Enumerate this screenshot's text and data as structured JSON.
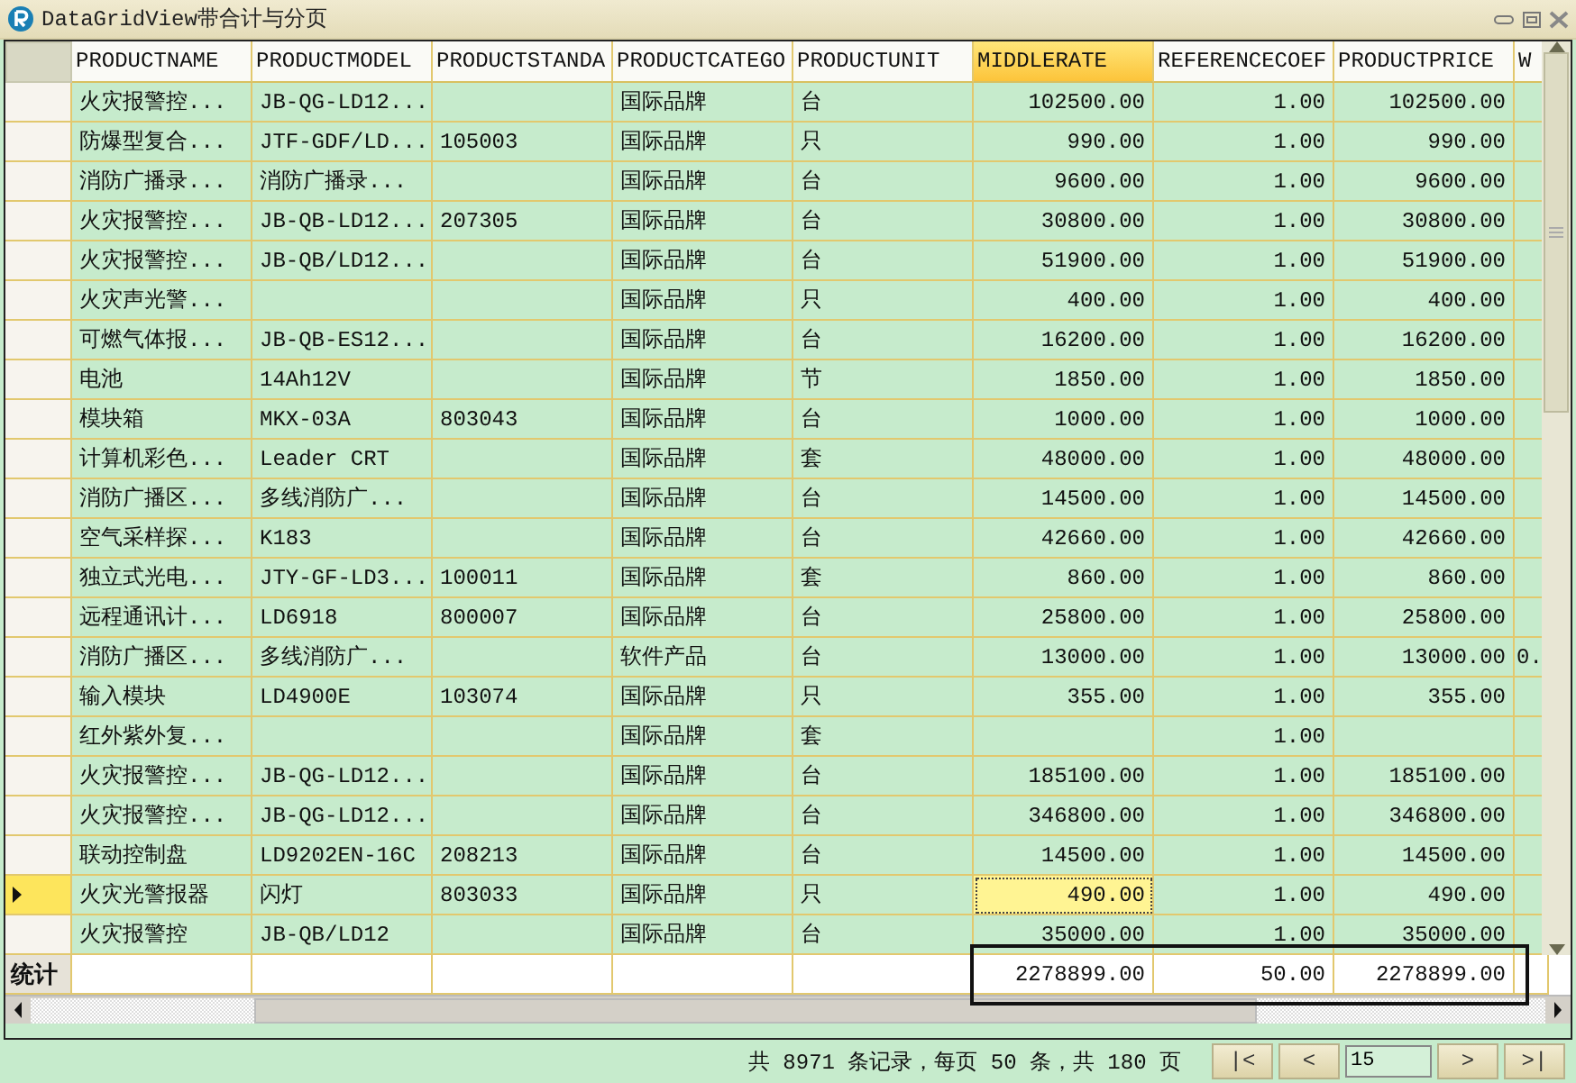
{
  "window": {
    "title": "DataGridView带合计与分页"
  },
  "grid": {
    "columns": [
      {
        "label": "PRODUCTNAME",
        "kind": "text",
        "selected": false
      },
      {
        "label": "PRODUCTMODEL",
        "kind": "text",
        "selected": false
      },
      {
        "label": "PRODUCTSTANDA",
        "kind": "text",
        "selected": false
      },
      {
        "label": "PRODUCTCATEGO",
        "kind": "text",
        "selected": false
      },
      {
        "label": "PRODUCTUNIT",
        "kind": "text",
        "selected": false
      },
      {
        "label": "MIDDLERATE",
        "kind": "number",
        "selected": true
      },
      {
        "label": "REFERENCECOEF",
        "kind": "number",
        "selected": false
      },
      {
        "label": "PRODUCTPRICE",
        "kind": "number",
        "selected": false
      },
      {
        "label": "W",
        "kind": "text",
        "selected": false
      }
    ],
    "rows": [
      {
        "selected": false,
        "cells": [
          "火灾报警控...",
          "JB-QG-LD12...",
          "",
          "国际品牌",
          "台",
          "102500.00",
          "1.00",
          "102500.00",
          ""
        ]
      },
      {
        "selected": false,
        "cells": [
          "防爆型复合...",
          "JTF-GDF/LD...",
          "105003",
          "国际品牌",
          "只",
          "990.00",
          "1.00",
          "990.00",
          ""
        ]
      },
      {
        "selected": false,
        "cells": [
          "消防广播录...",
          "消防广播录...",
          "",
          "国际品牌",
          "台",
          "9600.00",
          "1.00",
          "9600.00",
          ""
        ]
      },
      {
        "selected": false,
        "cells": [
          "火灾报警控...",
          "JB-QB-LD12...",
          "207305",
          "国际品牌",
          "台",
          "30800.00",
          "1.00",
          "30800.00",
          ""
        ]
      },
      {
        "selected": false,
        "cells": [
          "火灾报警控...",
          "JB-QB/LD12...",
          "",
          "国际品牌",
          "台",
          "51900.00",
          "1.00",
          "51900.00",
          ""
        ]
      },
      {
        "selected": false,
        "cells": [
          "火灾声光警...",
          "",
          "",
          "国际品牌",
          "只",
          "400.00",
          "1.00",
          "400.00",
          ""
        ]
      },
      {
        "selected": false,
        "cells": [
          "可燃气体报...",
          "JB-QB-ES12...",
          "",
          "国际品牌",
          "台",
          "16200.00",
          "1.00",
          "16200.00",
          ""
        ]
      },
      {
        "selected": false,
        "cells": [
          "电池",
          "14Ah12V",
          "",
          "国际品牌",
          "节",
          "1850.00",
          "1.00",
          "1850.00",
          ""
        ]
      },
      {
        "selected": false,
        "cells": [
          "模块箱",
          "MKX-03A",
          "803043",
          "国际品牌",
          "台",
          "1000.00",
          "1.00",
          "1000.00",
          ""
        ]
      },
      {
        "selected": false,
        "cells": [
          "计算机彩色...",
          "Leader CRT",
          "",
          "国际品牌",
          "套",
          "48000.00",
          "1.00",
          "48000.00",
          ""
        ]
      },
      {
        "selected": false,
        "cells": [
          "消防广播区...",
          "多线消防广...",
          "",
          "国际品牌",
          "台",
          "14500.00",
          "1.00",
          "14500.00",
          ""
        ]
      },
      {
        "selected": false,
        "cells": [
          "空气采样探...",
          "K183",
          "",
          "国际品牌",
          "台",
          "42660.00",
          "1.00",
          "42660.00",
          ""
        ]
      },
      {
        "selected": false,
        "cells": [
          "独立式光电...",
          "JTY-GF-LD3...",
          "100011",
          "国际品牌",
          "套",
          "860.00",
          "1.00",
          "860.00",
          ""
        ]
      },
      {
        "selected": false,
        "cells": [
          "远程通讯计...",
          "LD6918",
          "800007",
          "国际品牌",
          "台",
          "25800.00",
          "1.00",
          "25800.00",
          ""
        ]
      },
      {
        "selected": false,
        "cells": [
          "消防广播区...",
          "多线消防广...",
          "",
          "软件产品",
          "台",
          "13000.00",
          "1.00",
          "13000.00",
          "0."
        ]
      },
      {
        "selected": false,
        "cells": [
          "输入模块",
          "LD4900E",
          "103074",
          "国际品牌",
          "只",
          "355.00",
          "1.00",
          "355.00",
          ""
        ]
      },
      {
        "selected": false,
        "cells": [
          "红外紫外复...",
          "",
          "",
          "国际品牌",
          "套",
          "",
          "1.00",
          "",
          ""
        ]
      },
      {
        "selected": false,
        "cells": [
          "火灾报警控...",
          "JB-QG-LD12...",
          "",
          "国际品牌",
          "台",
          "185100.00",
          "1.00",
          "185100.00",
          ""
        ]
      },
      {
        "selected": false,
        "cells": [
          "火灾报警控...",
          "JB-QG-LD12...",
          "",
          "国际品牌",
          "台",
          "346800.00",
          "1.00",
          "346800.00",
          ""
        ]
      },
      {
        "selected": false,
        "cells": [
          "联动控制盘",
          "LD9202EN-16C",
          "208213",
          "国际品牌",
          "台",
          "14500.00",
          "1.00",
          "14500.00",
          ""
        ]
      },
      {
        "selected": true,
        "cells": [
          "火灾光警报器",
          "闪灯",
          "803033",
          "国际品牌",
          "只",
          "490.00",
          "1.00",
          "490.00",
          ""
        ]
      },
      {
        "selected": false,
        "cells": [
          "火灾报警控",
          "JB-QB/LD12",
          "",
          "国际品牌",
          "台",
          "35000.00",
          "1.00",
          "35000.00",
          ""
        ]
      }
    ],
    "totals": {
      "label": "统计",
      "marked": true,
      "cells": [
        "",
        "",
        "",
        "",
        "",
        "2278899.00",
        "50.00",
        "2278899.00",
        ""
      ]
    }
  },
  "pager": {
    "summary": "共 8971 条记录，每页 50 条，共 180 页",
    "buttons_before": [
      {
        "label": "|<"
      },
      {
        "label": "<"
      }
    ],
    "page_input": "15",
    "buttons_after": [
      {
        "label": ">"
      },
      {
        "label": ">|"
      }
    ]
  }
}
